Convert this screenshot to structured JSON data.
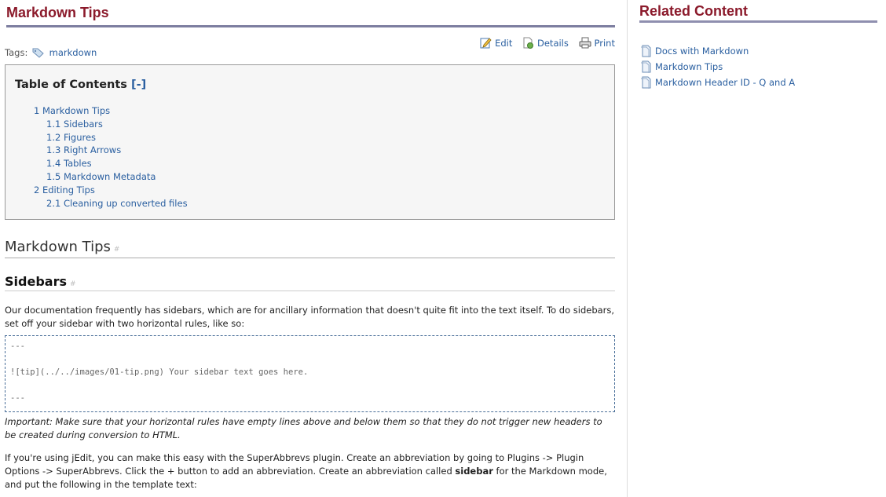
{
  "page": {
    "title": "Markdown Tips",
    "tags_label": "Tags:",
    "tag": "markdown",
    "actions": {
      "edit": "Edit",
      "details": "Details",
      "print": "Print"
    }
  },
  "toc": {
    "title": "Table of Contents",
    "toggle": "[-]",
    "items": [
      {
        "label": "1 Markdown Tips",
        "level": 1
      },
      {
        "label": "1.1 Sidebars",
        "level": 2
      },
      {
        "label": "1.2 Figures",
        "level": 2
      },
      {
        "label": "1.3 Right Arrows",
        "level": 2
      },
      {
        "label": "1.4 Tables",
        "level": 2
      },
      {
        "label": "1.5 Markdown Metadata",
        "level": 2
      },
      {
        "label": "2 Editing Tips",
        "level": 1
      },
      {
        "label": "2.1 Cleaning up converted files",
        "level": 2
      }
    ]
  },
  "content": {
    "h1": "Markdown Tips",
    "anchor": "#",
    "h2": "Sidebars",
    "p1": "Our documentation frequently has sidebars, which are for ancillary information that doesn't quite fit into the text itself. To do sidebars, set off your sidebar with two horizontal rules, like so:",
    "code": [
      "---",
      "![tip](../../images/01-tip.png) Your sidebar text goes here.",
      "---"
    ],
    "note": "Important: Make sure that your horizontal rules have empty lines above and below them so that they do not trigger new headers to be created during conversion to HTML.",
    "p2a": "If you're using jEdit, you can make this easy with the SuperAbbrevs plugin. Create an abbreviation by going to Plugins -> Plugin Options -> SuperAbbrevs. Click the + button to add an abbreviation. Create an abbreviation called ",
    "p2b": "sidebar",
    "p2c": " for the Markdown mode, and put the following in the template text:"
  },
  "related": {
    "title": "Related Content",
    "items": [
      "Docs with Markdown",
      "Markdown Tips",
      "Markdown Header ID - Q and A"
    ]
  },
  "colors": {
    "title": "#8b1a2b",
    "link": "#2a5fa0",
    "rule": "#7d7ea0"
  }
}
